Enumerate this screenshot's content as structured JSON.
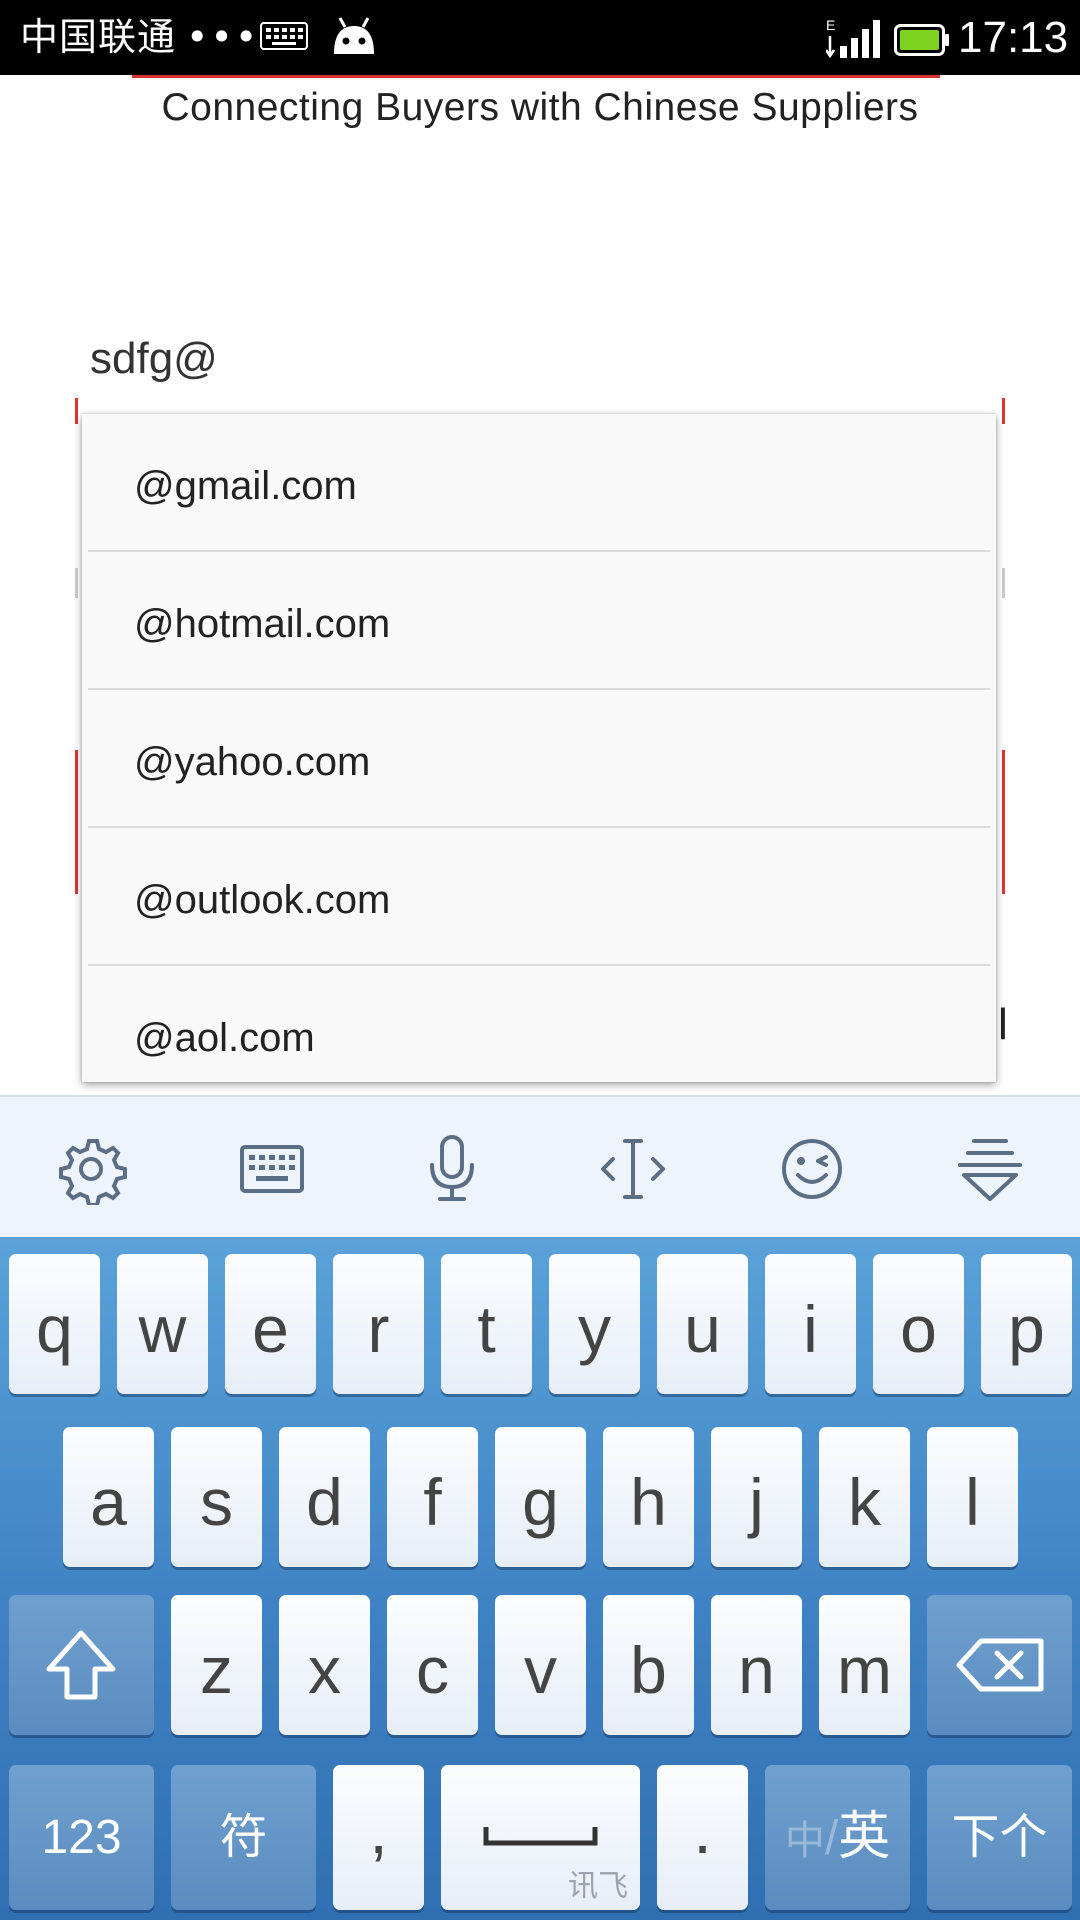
{
  "status_bar": {
    "carrier": "中国联通",
    "dots": "•••",
    "time": "17:13",
    "network_type": "E",
    "battery_color": "#7ed321"
  },
  "page": {
    "tagline": "Connecting Buyers with Chinese Suppliers",
    "email_value": "sdfg@",
    "partial_char": "l",
    "accent_color": "#d8322e"
  },
  "suggestions": [
    {
      "label": "@gmail.com"
    },
    {
      "label": "@hotmail.com"
    },
    {
      "label": "@yahoo.com"
    },
    {
      "label": "@outlook.com"
    },
    {
      "label": "@aol.com"
    }
  ],
  "keyboard_toolbar": {
    "icons": [
      "gear-icon",
      "keyboard-icon",
      "microphone-icon",
      "cursor-icon",
      "emoji-icon",
      "hide-keyboard-icon"
    ]
  },
  "keyboard": {
    "row1": [
      "q",
      "w",
      "e",
      "r",
      "t",
      "y",
      "u",
      "i",
      "o",
      "p"
    ],
    "row2": [
      "a",
      "s",
      "d",
      "f",
      "g",
      "h",
      "j",
      "k",
      "l"
    ],
    "row3": [
      "z",
      "x",
      "c",
      "v",
      "b",
      "n",
      "m"
    ],
    "numbers_label": "123",
    "symbols_label": "符",
    "comma_label": ",",
    "space_brand": "讯飞",
    "period_label": ".",
    "lang_zh": "中",
    "lang_sep": "/",
    "lang_en": "英",
    "next_label": "下个"
  }
}
